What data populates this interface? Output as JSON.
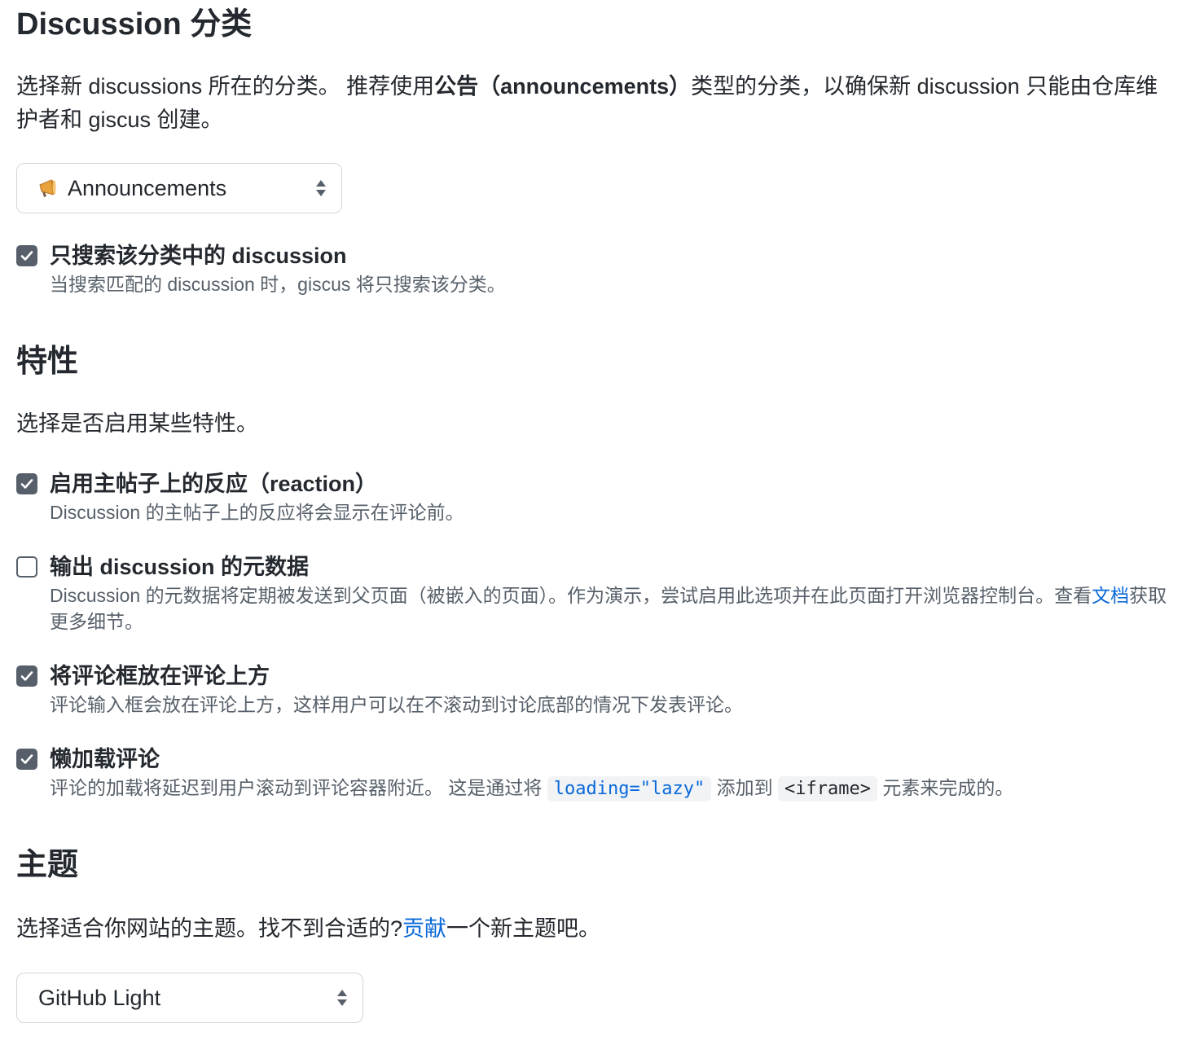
{
  "category": {
    "heading": "Discussion 分类",
    "intro_part1": "选择新 discussions 所在的分类。 推荐使用",
    "intro_bold": "公告（announcements）",
    "intro_part2": "类型的分类，以确保新 discussion 只能由仓库维护者和 giscus 创建。",
    "select_value": "Announcements",
    "select_icon": "megaphone-icon",
    "checkbox": {
      "title": "只搜索该分类中的 discussion",
      "description": "当搜索匹配的 discussion 时，giscus 将只搜索该分类。",
      "checked": true
    }
  },
  "features": {
    "heading": "特性",
    "intro": "选择是否启用某些特性。",
    "options": [
      {
        "title": "启用主帖子上的反应（reaction）",
        "description": "Discussion 的主帖子上的反应将会显示在评论前。",
        "checked": true
      },
      {
        "title": "输出 discussion 的元数据",
        "description_part1": "Discussion 的元数据将定期被发送到父页面（被嵌入的页面）。作为演示，尝试启用此选项并在此页面打开浏览器控制台。查看",
        "description_link": "文档",
        "description_part2": "获取更多细节。",
        "checked": false
      },
      {
        "title": "将评论框放在评论上方",
        "description": "评论输入框会放在评论上方，这样用户可以在不滚动到讨论底部的情况下发表评论。",
        "checked": true
      },
      {
        "title": "懒加载评论",
        "description_part1": "评论的加载将延迟到用户滚动到评论容器附近。 这是通过将",
        "code1": "loading=\"lazy\"",
        "description_part2": "添加到",
        "code2": "<iframe>",
        "description_part3": "元素来完成的。",
        "checked": true
      }
    ]
  },
  "theme": {
    "heading": "主题",
    "intro_part1": "选择适合你网站的主题。找不到合适的?",
    "intro_link": "贡献",
    "intro_part2": "一个新主题吧。",
    "select_value": "GitHub Light"
  },
  "colors": {
    "text": "#24292f",
    "muted": "#57606a",
    "link": "#0969da",
    "border": "#d0d7de",
    "checkbox": "#57606a"
  }
}
